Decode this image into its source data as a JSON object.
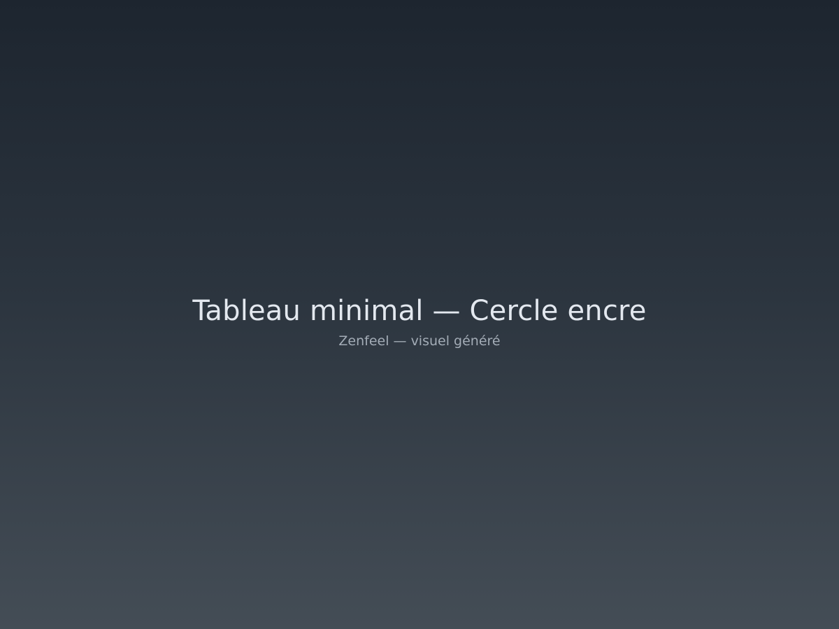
{
  "scene": {
    "title": "Tableau minimal — Cercle encre",
    "subtitle": "Zenfeel — visuel généré"
  },
  "colors": {
    "background_top": "#1d252f",
    "background_bottom": "#444d56",
    "title_text": "#e3e8ef",
    "subtitle_text": "#a3acb6"
  }
}
